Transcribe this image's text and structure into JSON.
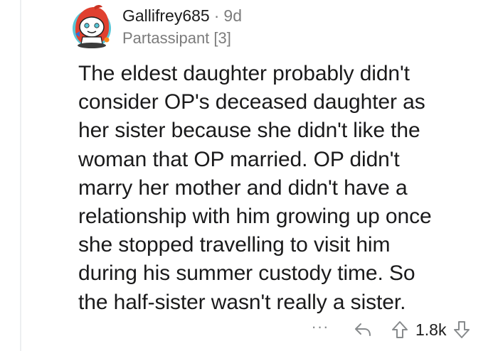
{
  "comment": {
    "username": "Gallifrey685",
    "separator": "·",
    "age": "9d",
    "flair": "Partassipant [3]",
    "body_lines": [
      "The eldest daughter probably didn't",
      "consider OP's deceased daughter as",
      "her sister because she didn't like the",
      "woman that OP married. OP didn't",
      "marry her mother and didn't have a",
      "relationship with him growing up once",
      "she stopped travelling to visit him",
      "during his summer custody time. So",
      "the half-sister wasn't really a sister."
    ],
    "score": "1.8k",
    "more_label": "···"
  },
  "colors": {
    "text": "#1a1a1b",
    "muted": "#7c7c7c",
    "thread_line": "#edeff1",
    "avatar_red": "#e0402f",
    "avatar_teal": "#58c7d8"
  },
  "icons": {
    "avatar": "snoo-avatar-icon",
    "more": "more-options-icon",
    "reply": "reply-arrow-icon",
    "upvote": "upvote-arrow-icon",
    "downvote": "downvote-arrow-icon"
  }
}
